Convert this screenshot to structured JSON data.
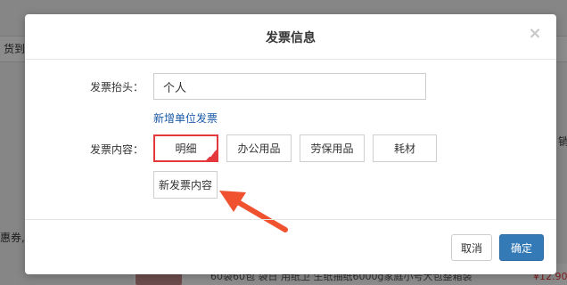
{
  "background": {
    "deliver_label": "货到",
    "coupon_text": "惠券,",
    "promo_text": "60袋60包 袋日 用纸卫 生纸抽纸6000g家庭小号大包整箱装",
    "price_text": "¥12.90",
    "right_edge_text": "销"
  },
  "modal": {
    "title": "发票信息",
    "close_symbol": "×",
    "invoice_title_label": "发票抬头：",
    "invoice_title_value": "个人",
    "add_company_link": "新增单位发票",
    "invoice_content_label": "发票内容：",
    "content_options": [
      {
        "label": "明细",
        "selected": true
      },
      {
        "label": "办公用品",
        "selected": false
      },
      {
        "label": "劳保用品",
        "selected": false
      },
      {
        "label": "耗材",
        "selected": false
      }
    ],
    "new_content_button": "新发票内容",
    "cancel_button": "取消",
    "confirm_button": "确定"
  },
  "colors": {
    "accent_red": "#e4393c",
    "link_blue": "#1a5aa8",
    "primary_blue": "#337ab7",
    "arrow_color": "#f0522f"
  }
}
